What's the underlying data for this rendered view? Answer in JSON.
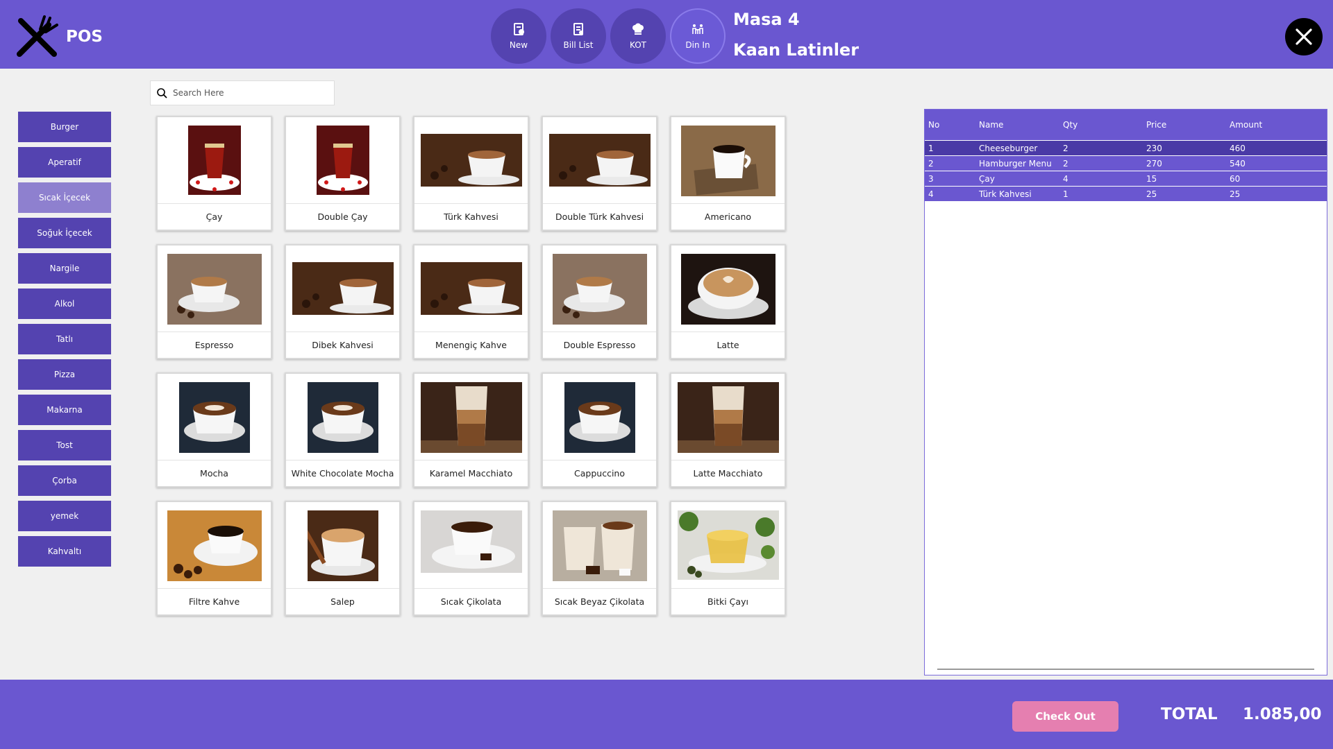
{
  "app": {
    "title": "POS"
  },
  "toolbar": {
    "buttons": [
      {
        "label": "New"
      },
      {
        "label": "Bill List"
      },
      {
        "label": "KOT"
      },
      {
        "label": "Din In"
      }
    ]
  },
  "header": {
    "table": "Masa 4",
    "customer": "Kaan Latinler"
  },
  "search": {
    "placeholder": "Search Here"
  },
  "categories": [
    {
      "label": "Burger"
    },
    {
      "label": "Aperatif"
    },
    {
      "label": "Sıcak İçecek"
    },
    {
      "label": "Soğuk İçecek"
    },
    {
      "label": "Nargile"
    },
    {
      "label": "Alkol"
    },
    {
      "label": "Tatlı"
    },
    {
      "label": "Pizza"
    },
    {
      "label": "Makarna"
    },
    {
      "label": "Tost"
    },
    {
      "label": "Çorba"
    },
    {
      "label": "yemek"
    },
    {
      "label": "Kahvaltı"
    }
  ],
  "products": [
    {
      "name": "Çay"
    },
    {
      "name": "Double Çay"
    },
    {
      "name": "Türk Kahvesi"
    },
    {
      "name": "Double Türk Kahvesi"
    },
    {
      "name": "Americano"
    },
    {
      "name": "Espresso"
    },
    {
      "name": "Dibek Kahvesi"
    },
    {
      "name": "Menengiç Kahve"
    },
    {
      "name": "Double Espresso"
    },
    {
      "name": "Latte"
    },
    {
      "name": "Mocha"
    },
    {
      "name": "White Chocolate Mocha"
    },
    {
      "name": "Karamel Macchiato"
    },
    {
      "name": "Cappuccino"
    },
    {
      "name": "Latte Macchiato"
    },
    {
      "name": "Filtre Kahve"
    },
    {
      "name": "Salep"
    },
    {
      "name": "Sıcak Çikolata"
    },
    {
      "name": "Sıcak Beyaz Çikolata"
    },
    {
      "name": "Bitki Çayı"
    }
  ],
  "order": {
    "headers": {
      "no": "No",
      "name": "Name",
      "qty": "Qty",
      "price": "Price",
      "amount": "Amount"
    },
    "rows": [
      {
        "no": "1",
        "name": "Cheeseburger",
        "qty": "2",
        "price": "230",
        "amount": "460"
      },
      {
        "no": "2",
        "name": "Hamburger Menu",
        "qty": "2",
        "price": "270",
        "amount": "540"
      },
      {
        "no": "3",
        "name": "Çay",
        "qty": "4",
        "price": "15",
        "amount": "60"
      },
      {
        "no": "4",
        "name": "Türk Kahvesi",
        "qty": "1",
        "price": "25",
        "amount": "25"
      }
    ]
  },
  "footer": {
    "checkout": "Check Out",
    "total_label": "TOTAL",
    "total_value": "1.085,00"
  },
  "colors": {
    "primary": "#6a57d0",
    "dark": "#5443b0",
    "selected_category": "#8e80cf",
    "checkout": "#e57fb0"
  }
}
